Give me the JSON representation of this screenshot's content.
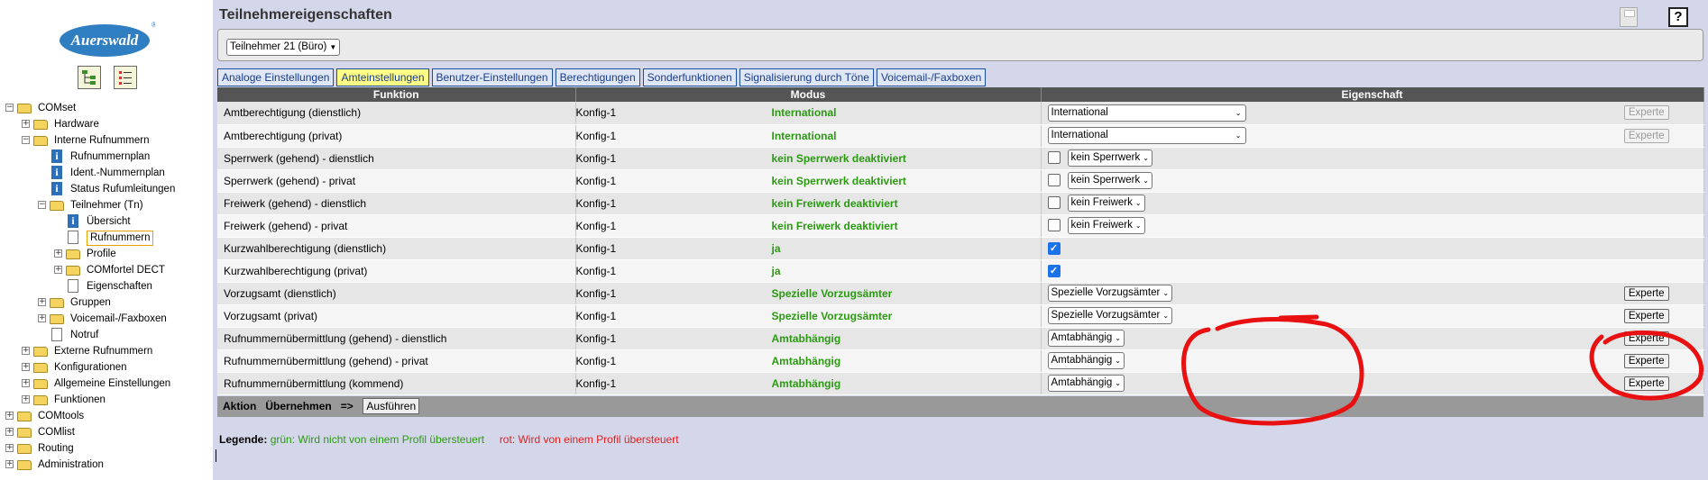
{
  "sidebar": {
    "logo_text": "Auerswald",
    "tree": [
      {
        "label": "COMset",
        "level": 0,
        "kind": "folder",
        "sign": "−"
      },
      {
        "label": "Hardware",
        "level": 1,
        "kind": "folder",
        "sign": "+"
      },
      {
        "label": "Interne Rufnummern",
        "level": 1,
        "kind": "folder",
        "sign": "−"
      },
      {
        "label": "Rufnummernplan",
        "level": 2,
        "kind": "info"
      },
      {
        "label": "Ident.-Nummernplan",
        "level": 2,
        "kind": "info"
      },
      {
        "label": "Status Rufumleitungen",
        "level": 2,
        "kind": "info"
      },
      {
        "label": "Teilnehmer (Tn)",
        "level": 2,
        "kind": "folder",
        "sign": "−"
      },
      {
        "label": "Übersicht",
        "level": 3,
        "kind": "info"
      },
      {
        "label": "Rufnummern",
        "level": 3,
        "kind": "doc",
        "selected": true
      },
      {
        "label": "Profile",
        "level": 3,
        "kind": "folder",
        "sign": "+"
      },
      {
        "label": "COMfortel DECT",
        "level": 3,
        "kind": "folder",
        "sign": "+"
      },
      {
        "label": "Eigenschaften",
        "level": 3,
        "kind": "doc"
      },
      {
        "label": "Gruppen",
        "level": 2,
        "kind": "folder",
        "sign": "+"
      },
      {
        "label": "Voicemail-/Faxboxen",
        "level": 2,
        "kind": "folder",
        "sign": "+"
      },
      {
        "label": "Notruf",
        "level": 2,
        "kind": "doc"
      },
      {
        "label": "Externe Rufnummern",
        "level": 1,
        "kind": "folder",
        "sign": "+"
      },
      {
        "label": "Konfigurationen",
        "level": 1,
        "kind": "folder",
        "sign": "+"
      },
      {
        "label": "Allgemeine Einstellungen",
        "level": 1,
        "kind": "folder",
        "sign": "+"
      },
      {
        "label": "Funktionen",
        "level": 1,
        "kind": "folder",
        "sign": "+"
      },
      {
        "label": "COMtools",
        "level": 0,
        "kind": "folder",
        "sign": "+"
      },
      {
        "label": "COMlist",
        "level": 0,
        "kind": "folder",
        "sign": "+"
      },
      {
        "label": "Routing",
        "level": 0,
        "kind": "folder",
        "sign": "+"
      },
      {
        "label": "Administration",
        "level": 0,
        "kind": "folder",
        "sign": "+"
      }
    ]
  },
  "main": {
    "title": "Teilnehmereigenschaften",
    "participant_select": "Teilnehmer 21 (Büro)",
    "help_label": "?",
    "tabs": [
      {
        "label": "Analoge Einstellungen"
      },
      {
        "label": "Amteinstellungen",
        "active": true
      },
      {
        "label": "Benutzer-Einstellungen"
      },
      {
        "label": "Berechtigungen"
      },
      {
        "label": "Sonderfunktionen"
      },
      {
        "label": "Signalisierung durch Töne"
      },
      {
        "label": "Voicemail-/Faxboxen"
      }
    ],
    "table": {
      "headers": {
        "funktion": "Funktion",
        "modus": "Modus",
        "eigenschaft": "Eigenschaft"
      },
      "rows": [
        {
          "funktion": "Amtberechtigung (dienstlich)",
          "config": "Konfig-1",
          "modus": "International",
          "ctrl": "select",
          "value": "International",
          "wide": true,
          "expert": "disabled"
        },
        {
          "funktion": "Amtberechtigung (privat)",
          "config": "Konfig-1",
          "modus": "International",
          "ctrl": "select",
          "value": "International",
          "wide": true,
          "expert": "disabled"
        },
        {
          "funktion": "Sperrwerk (gehend) - dienstlich",
          "config": "Konfig-1",
          "modus": "kein Sperrwerk deaktiviert",
          "ctrl": "check-select",
          "checked": false,
          "value": "kein Sperrwerk"
        },
        {
          "funktion": "Sperrwerk (gehend) - privat",
          "config": "Konfig-1",
          "modus": "kein Sperrwerk deaktiviert",
          "ctrl": "check-select",
          "checked": false,
          "value": "kein Sperrwerk"
        },
        {
          "funktion": "Freiwerk (gehend) - dienstlich",
          "config": "Konfig-1",
          "modus": "kein Freiwerk deaktiviert",
          "ctrl": "check-select",
          "checked": false,
          "value": "kein Freiwerk"
        },
        {
          "funktion": "Freiwerk (gehend) - privat",
          "config": "Konfig-1",
          "modus": "kein Freiwerk deaktiviert",
          "ctrl": "check-select",
          "checked": false,
          "value": "kein Freiwerk"
        },
        {
          "funktion": "Kurzwahlberechtigung (dienstlich)",
          "config": "Konfig-1",
          "modus": "ja",
          "ctrl": "check",
          "checked": true
        },
        {
          "funktion": "Kurzwahlberechtigung (privat)",
          "config": "Konfig-1",
          "modus": "ja",
          "ctrl": "check",
          "checked": true
        },
        {
          "funktion": "Vorzugsamt (dienstlich)",
          "config": "Konfig-1",
          "modus": "Spezielle Vorzugsämter",
          "ctrl": "select",
          "value": "Spezielle Vorzugsämter",
          "expert": "enabled"
        },
        {
          "funktion": "Vorzugsamt (privat)",
          "config": "Konfig-1",
          "modus": "Spezielle Vorzugsämter",
          "ctrl": "select",
          "value": "Spezielle Vorzugsämter",
          "expert": "enabled"
        },
        {
          "funktion": "Rufnummernübermittlung (gehend) - dienstlich",
          "config": "Konfig-1",
          "modus": "Amtabhängig",
          "ctrl": "select",
          "value": "Amtabhängig",
          "expert": "enabled"
        },
        {
          "funktion": "Rufnummernübermittlung (gehend) - privat",
          "config": "Konfig-1",
          "modus": "Amtabhängig",
          "ctrl": "select",
          "value": "Amtabhängig",
          "expert": "enabled"
        },
        {
          "funktion": "Rufnummernübermittlung (kommend)",
          "config": "Konfig-1",
          "modus": "Amtabhängig",
          "ctrl": "select",
          "value": "Amtabhängig",
          "expert": "enabled"
        }
      ],
      "expert_label": "Experte"
    },
    "action_bar": {
      "label": "Aktion",
      "value": "Übernehmen",
      "arrow": "=>",
      "button": "Ausführen"
    },
    "legend": {
      "title": "Legende:",
      "green": "grün: Wird nicht von einem Profil übersteuert",
      "red": "rot: Wird von einem Profil übersteuert"
    }
  },
  "colors": {
    "accent": "#1f4e9a",
    "mode_green": "#2a9a10",
    "annotation_red": "#e81010",
    "bg": "#d4d7ea"
  }
}
